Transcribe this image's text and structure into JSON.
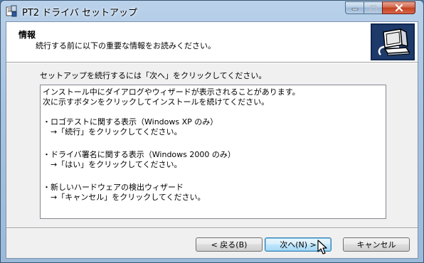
{
  "window": {
    "title": "PT2 ドライバ セットアップ",
    "controls": [
      "minimize-icon",
      "maximize-icon",
      "close-icon"
    ]
  },
  "header": {
    "title": "情報",
    "subtitle": "続行する前に以下の重要な情報をお読みください。",
    "logo_icon": "installer-computer-icon"
  },
  "main": {
    "instruction": "セットアップを続行するには「次へ」をクリックしてください。",
    "memo_lines": [
      "インストール中にダイアログやウィザードが表示されることがあります。",
      "次に示すボタンをクリックしてインストールを続けてください。",
      "",
      "・ロゴテストに関する表示（Windows XP のみ）",
      "　→「続行」をクリックしてください。",
      "",
      "・ドライバ署名に関する表示（Windows 2000 のみ）",
      "　→「はい」をクリックしてください。",
      "",
      "・新しいハードウェアの検出ウィザード",
      "　→「キャンセル」をクリックしてください。"
    ]
  },
  "buttons": {
    "back": "< 戻る(B)",
    "next": "次へ(N) >",
    "cancel": "キャンセル"
  },
  "colors": {
    "title_bar": "#a7c3e0",
    "client_bg": "#f0f0f0",
    "close_button": "#c2411f",
    "default_button_border": "#3c7fb1"
  }
}
